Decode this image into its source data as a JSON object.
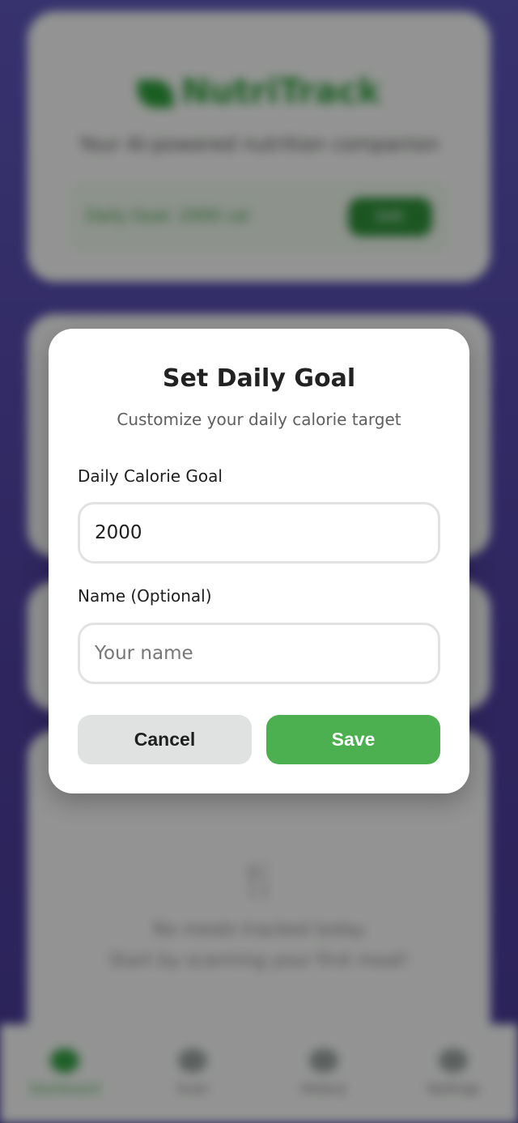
{
  "background": {
    "brand": "NutriTrack",
    "tagline": "Your AI-powered nutrition companion",
    "goal_text": "Daily Goal: 2000 cal",
    "edit_label": "Edit",
    "meals_empty_line1": "No meals tracked today",
    "meals_empty_line2": "Start by scanning your first meal!",
    "nav": [
      {
        "label": "Dashboard",
        "icon": "home-icon",
        "active": true
      },
      {
        "label": "Scan",
        "icon": "camera-icon",
        "active": false
      },
      {
        "label": "History",
        "icon": "history-icon",
        "active": false
      },
      {
        "label": "Settings",
        "icon": "gear-icon",
        "active": false
      }
    ]
  },
  "modal": {
    "title": "Set Daily Goal",
    "subtitle": "Customize your daily calorie target",
    "goal_label": "Daily Calorie Goal",
    "goal_value": "2000",
    "name_label": "Name (Optional)",
    "name_placeholder": "Your name",
    "name_value": "",
    "cancel_label": "Cancel",
    "save_label": "Save"
  },
  "colors": {
    "accent": "#4caf50",
    "cancel_bg": "#e0e1e1",
    "background_gradient_top": "#5d55b8",
    "background_gradient_bottom": "#473a95"
  }
}
